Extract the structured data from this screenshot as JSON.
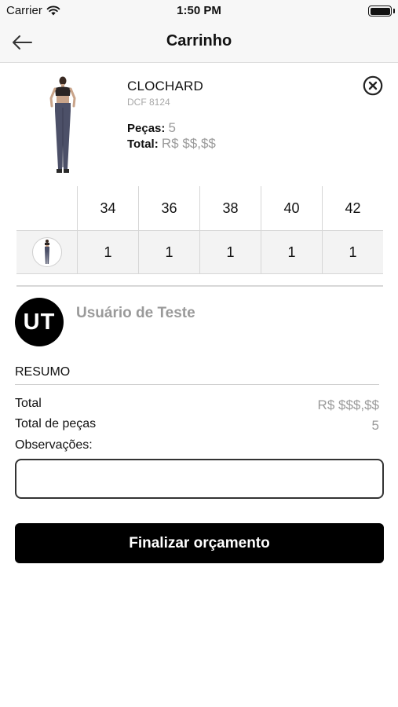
{
  "status_bar": {
    "carrier": "Carrier",
    "time": "1:50 PM"
  },
  "nav": {
    "title": "Carrinho"
  },
  "product": {
    "name": "CLOCHARD",
    "code": "DCF 8124",
    "qty_label": "Peças:",
    "qty_value": "5",
    "total_label": "Total:",
    "total_value": "R$ $$,$$"
  },
  "size_grid": {
    "sizes": [
      "34",
      "36",
      "38",
      "40",
      "42"
    ],
    "quantities": [
      "1",
      "1",
      "1",
      "1",
      "1"
    ]
  },
  "user": {
    "initials": "UT",
    "name": "Usuário de Teste"
  },
  "summary": {
    "heading": "RESUMO",
    "total_label": "Total",
    "total_value": "R$ $$$,$$",
    "pieces_label": "Total de peças",
    "pieces_value": "5",
    "notes_label": "Observações:"
  },
  "notes_input": {
    "value": "",
    "placeholder": ""
  },
  "actions": {
    "finish_label": "Finalizar orçamento"
  },
  "colors": {
    "primary": "#000000",
    "muted_text": "#9a9a9a",
    "grid_row_bg": "#f3f3f3"
  }
}
